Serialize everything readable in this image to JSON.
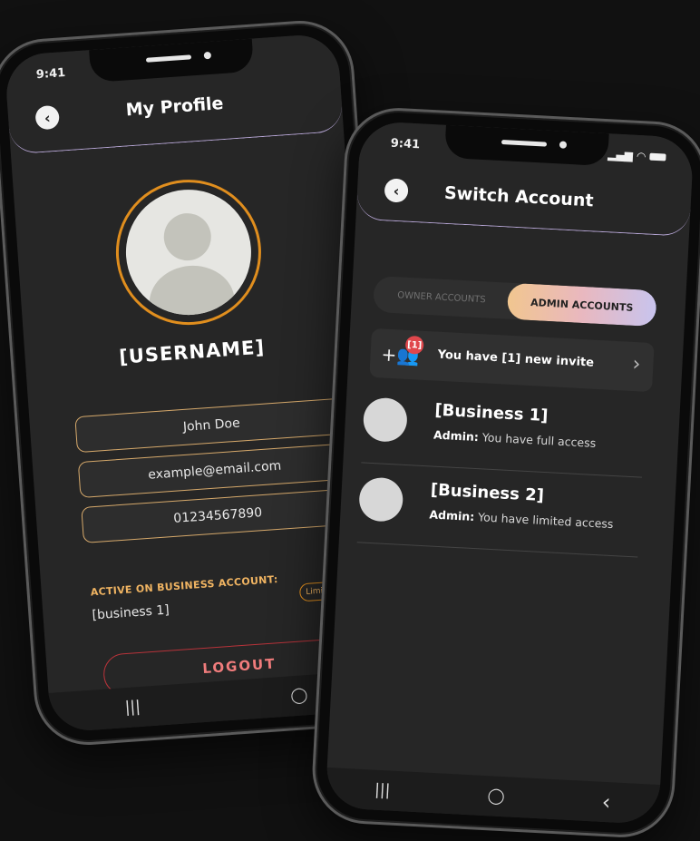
{
  "profile_phone": {
    "status_time": "9:41",
    "title": "My Profile",
    "username": "[USERNAME]",
    "fields": {
      "name": "John Doe",
      "email": "example@email.com",
      "phone": "01234567890"
    },
    "active_label": "ACTIVE ON BUSINESS ACCOUNT:",
    "active_value": "[business 1]",
    "badge": "Limited",
    "logout_label": "LOGOUT",
    "nav": {
      "recent": "|||",
      "home": "◯"
    }
  },
  "switch_phone": {
    "status_time": "9:41",
    "title": "Switch Account",
    "tabs": {
      "owner": "OWNER ACCOUNTS",
      "admin": "ADMIN ACCOUNTS"
    },
    "invite": {
      "badge": "[1]",
      "text": "You have [1] new invite"
    },
    "accounts": [
      {
        "name": "[Business 1]",
        "role": "Admin:",
        "access": "You have full access"
      },
      {
        "name": "[Business 2]",
        "role": "Admin:",
        "access": "You have limited access"
      }
    ],
    "nav": {
      "recent": "|||",
      "home": "◯",
      "back": "‹"
    }
  },
  "colors": {
    "background": "#111111",
    "screen": "#262626",
    "accent_orange": "#e08e1e",
    "logout_red": "#b8333a",
    "badge_red": "#e0474c"
  }
}
